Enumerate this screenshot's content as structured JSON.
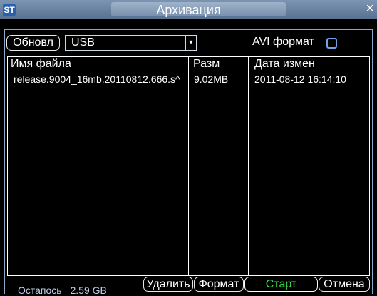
{
  "window": {
    "logo": "ST",
    "title": "Архивация",
    "close": "×"
  },
  "toolbar": {
    "refresh_label": "Обновл",
    "device_selected": "USB",
    "avi_label": "AVI формат",
    "avi_checked": false
  },
  "table": {
    "headers": [
      "Имя файла",
      "Разм",
      "Дата измен"
    ],
    "rows": [
      {
        "name": "release.9004_16mb.20110812.666.s^",
        "size": "9.02MB",
        "date": "2011-08-12 16:14:10"
      }
    ]
  },
  "footer": {
    "remaining_label": "Остапось",
    "remaining_value": "2.59 GB",
    "delete_label": "Удалить",
    "format_label": "Формат",
    "start_label": "Старт",
    "cancel_label": "Отмена"
  },
  "colors": {
    "titlebar": "#6b84a3",
    "panel_border": "#8aa9c9",
    "start_text": "#39d84b",
    "checkbox_border": "#6fa5e8"
  }
}
